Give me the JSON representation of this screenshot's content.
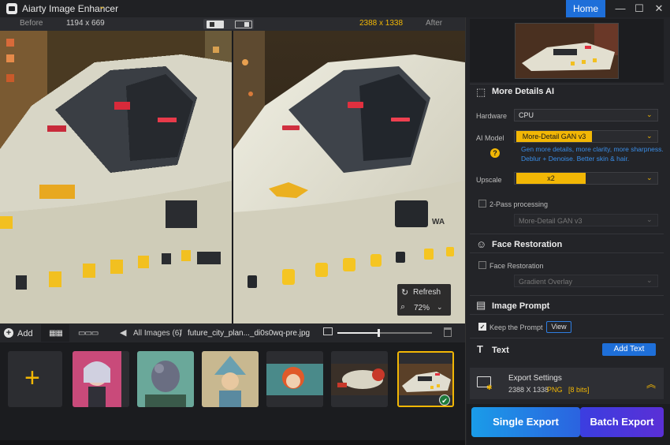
{
  "app": {
    "title": "Aiarty Image Enhancer",
    "home": "Home"
  },
  "window_controls": {
    "minimize": "—",
    "maximize": "☐",
    "close": "✕"
  },
  "compare": {
    "before_label": "Before",
    "before_size": "1194 x 669",
    "after_size": "2388 x 1338",
    "after_label": "After"
  },
  "overlay": {
    "refresh": "Refresh",
    "zoom": "72%"
  },
  "toolbar": {
    "add": "Add",
    "all_images": "All Images (6)",
    "separator": "/",
    "file_name": "future_city_plan..._di0s0wq-pre.jpg"
  },
  "thumbnails": {
    "count": 6,
    "selected_index": 5
  },
  "panel": {
    "more_details": {
      "title": "More Details AI",
      "hardware_label": "Hardware",
      "hardware_value": "CPU",
      "ai_model_label": "AI Model",
      "ai_model_value": "More-Detail GAN  v3",
      "model_desc_1": "Gen more details, more clarity, more sharpness.",
      "model_desc_2": "Deblur + Denoise. Better skin & hair.",
      "upscale_label": "Upscale",
      "upscale_value": "x2",
      "two_pass_label": "2-Pass processing",
      "two_pass_model": "More-Detail GAN  v3"
    },
    "face": {
      "title": "Face Restoration",
      "checkbox_label": "Face Restoration",
      "mode": "Gradient Overlay"
    },
    "prompt": {
      "title": "Image Prompt",
      "keep_label": "Keep the Prompt",
      "view": "View"
    },
    "text": {
      "title": "Text",
      "add_text": "Add Text"
    },
    "export": {
      "title": "Export Settings",
      "size": "2388 X 1338",
      "format": "PNG",
      "bits": "[8 bits]"
    },
    "buttons": {
      "single_export": "Single Export",
      "batch_export": "Batch Export"
    }
  },
  "colors": {
    "accent_yellow": "#f2b705",
    "primary_blue": "#1e6fd9",
    "panel_bg": "#232428"
  }
}
